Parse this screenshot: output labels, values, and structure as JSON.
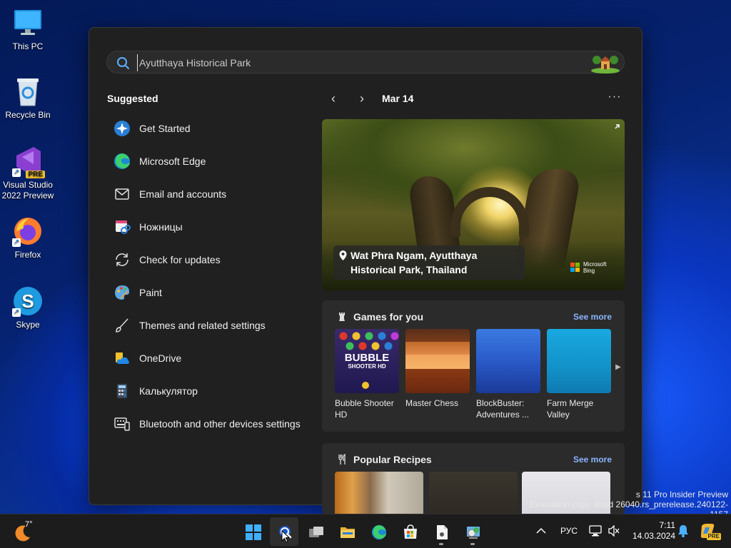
{
  "desktop": {
    "icons": [
      {
        "label": "This PC"
      },
      {
        "label": "Recycle Bin"
      },
      {
        "label": "Visual Studio 2022 Preview",
        "badge": "PRE"
      },
      {
        "label": "Firefox"
      },
      {
        "label": "Skype"
      }
    ]
  },
  "search": {
    "value": "Ayutthaya Historical Park"
  },
  "suggested": {
    "title": "Suggested",
    "items": [
      {
        "label": "Get Started",
        "icon": "get-started-icon"
      },
      {
        "label": "Microsoft Edge",
        "icon": "edge-icon"
      },
      {
        "label": "Email and accounts",
        "icon": "mail-icon"
      },
      {
        "label": "Ножницы",
        "icon": "snipping-tool-icon"
      },
      {
        "label": "Check for updates",
        "icon": "sync-icon"
      },
      {
        "label": "Paint",
        "icon": "paint-icon"
      },
      {
        "label": "Themes and related settings",
        "icon": "brush-icon"
      },
      {
        "label": "OneDrive",
        "icon": "onedrive-icon"
      },
      {
        "label": "Калькулятор",
        "icon": "calculator-icon"
      },
      {
        "label": "Bluetooth and other devices settings",
        "icon": "keyboard-devices-icon"
      }
    ]
  },
  "highlights": {
    "date": "Mar 14",
    "prev": "‹",
    "next": "›",
    "more": "···",
    "hero": {
      "caption_line1": "Wat Phra Ngam, Ayutthaya",
      "caption_line2": "Historical Park, Thailand",
      "brand_line1": "Microsoft",
      "brand_line2": "Bing"
    }
  },
  "games": {
    "title": "Games for you",
    "see_more": "See more",
    "items": [
      {
        "name": "Bubble Shooter HD",
        "thumb_text_1": "BUBBLE",
        "thumb_text_2": "SHOOTER HD"
      },
      {
        "name": "Master Chess"
      },
      {
        "name": "BlockBuster: Adventures ..."
      },
      {
        "name": "Farm Merge Valley"
      }
    ]
  },
  "recipes": {
    "title": "Popular Recipes",
    "see_more": "See more"
  },
  "watermark": {
    "line1": "s 11 Pro Insider Preview",
    "line2": "Evaluation copy. Build 26040.rs_prerelease.240122-1157"
  },
  "taskbar": {
    "weather_temp": "7°",
    "language": "РУС",
    "time": "7:11",
    "date": "14.03.2024",
    "copilot_badge": "PRE"
  },
  "colors": {
    "accent_link": "#8ab4ff",
    "panel_bg": "#202020",
    "card_bg": "#2b2b2b",
    "taskbar_bg": "#1c1c1c"
  }
}
